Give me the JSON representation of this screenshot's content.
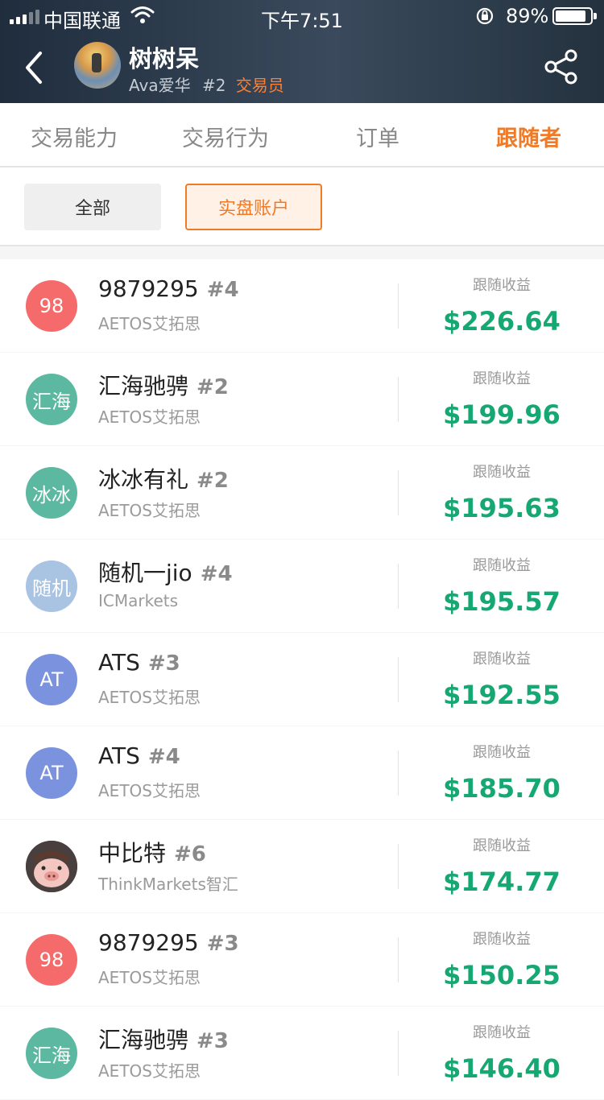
{
  "status_bar": {
    "carrier": "中国联通",
    "time": "下午7:51",
    "battery": "89%",
    "battery_level": 0.89
  },
  "header": {
    "trader_name": "树树呆",
    "sub_name": "Ava爱华",
    "rank": "#2",
    "role": "交易员",
    "back_icon": "chevron-left-icon",
    "share_icon": "share-icon"
  },
  "tabs": [
    {
      "label": "交易能力"
    },
    {
      "label": "交易行为"
    },
    {
      "label": "订单"
    },
    {
      "label": "跟随者"
    }
  ],
  "filters": {
    "all": "全部",
    "live": "实盘账户"
  },
  "followers": [
    {
      "avatar_text": "98",
      "avatar_color": "#f56b6b",
      "name": "9879295",
      "rank": "#4",
      "broker": "AETOS艾拓思",
      "profit_label": "跟随收益",
      "profit": "$226.64"
    },
    {
      "avatar_text": "汇海",
      "avatar_color": "#5cb8a0",
      "name": "汇海驰骋",
      "rank": "#2",
      "broker": "AETOS艾拓思",
      "profit_label": "跟随收益",
      "profit": "$199.96"
    },
    {
      "avatar_text": "冰冰",
      "avatar_color": "#5cb8a0",
      "name": "冰冰有礼",
      "rank": "#2",
      "broker": "AETOS艾拓思",
      "profit_label": "跟随收益",
      "profit": "$195.63"
    },
    {
      "avatar_text": "随机",
      "avatar_color": "#a9c3e2",
      "name": "随机一jio",
      "rank": "#4",
      "broker": "ICMarkets",
      "profit_label": "跟随收益",
      "profit": "$195.57"
    },
    {
      "avatar_text": "AT",
      "avatar_color": "#7b93de",
      "name": "ATS",
      "rank": "#3",
      "broker": "AETOS艾拓思",
      "profit_label": "跟随收益",
      "profit": "$192.55"
    },
    {
      "avatar_text": "AT",
      "avatar_color": "#7b93de",
      "name": "ATS",
      "rank": "#4",
      "broker": "AETOS艾拓思",
      "profit_label": "跟随收益",
      "profit": "$185.70"
    },
    {
      "avatar_text": "",
      "avatar_color": "#e9b8b4",
      "name": "中比特",
      "rank": "#6",
      "broker": "ThinkMarkets智汇",
      "profit_label": "跟随收益",
      "profit": "$174.77"
    },
    {
      "avatar_text": "98",
      "avatar_color": "#f56b6b",
      "name": "9879295",
      "rank": "#3",
      "broker": "AETOS艾拓思",
      "profit_label": "跟随收益",
      "profit": "$150.25"
    },
    {
      "avatar_text": "汇海",
      "avatar_color": "#5cb8a0",
      "name": "汇海驰骋",
      "rank": "#3",
      "broker": "AETOS艾拓思",
      "profit_label": "跟随收益",
      "profit": "$146.40"
    }
  ]
}
